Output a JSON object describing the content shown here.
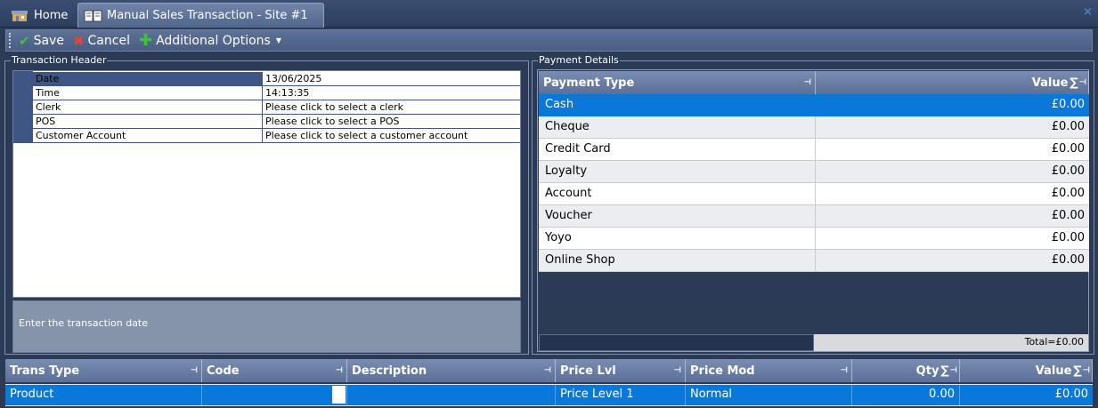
{
  "tabs": {
    "home": "Home",
    "active": "Manual Sales Transaction - Site #1",
    "close_glyph": "×"
  },
  "toolbar": {
    "save": "Save",
    "cancel": "Cancel",
    "additional": "Additional Options",
    "check_glyph": "✔",
    "x_glyph": "✖",
    "plus_glyph": "✚",
    "caret_glyph": "▼"
  },
  "transaction_header": {
    "title": "Transaction Header",
    "rows": [
      {
        "label": "Date",
        "value": "13/06/2025"
      },
      {
        "label": "Time",
        "value": "14:13:35"
      },
      {
        "label": "Clerk",
        "value": "Please click to select a clerk"
      },
      {
        "label": "POS",
        "value": "Please click to select a POS"
      },
      {
        "label": "Customer Account",
        "value": "Please click to select a customer account"
      }
    ],
    "hint": "Enter the transaction date"
  },
  "payment_details": {
    "title": "Payment Details",
    "col_type": "Payment Type",
    "col_value": "Value",
    "sigma": "∑",
    "pin": "⊣",
    "rows": [
      {
        "type": "Cash",
        "value": "£0.00"
      },
      {
        "type": "Cheque",
        "value": "£0.00"
      },
      {
        "type": "Credit Card",
        "value": "£0.00"
      },
      {
        "type": "Loyalty",
        "value": "£0.00"
      },
      {
        "type": "Account",
        "value": "£0.00"
      },
      {
        "type": "Voucher",
        "value": "£0.00"
      },
      {
        "type": "Yoyo",
        "value": "£0.00"
      },
      {
        "type": "Online Shop",
        "value": "£0.00"
      }
    ],
    "total": "Total=£0.00"
  },
  "lines": {
    "columns": {
      "trans_type": "Trans Type",
      "code": "Code",
      "description": "Description",
      "price_lvl": "Price Lvl",
      "price_mod": "Price Mod",
      "qty": "Qty",
      "value": "Value"
    },
    "row": {
      "trans_type": "Product",
      "code": "",
      "description": "",
      "price_lvl": "Price Level 1",
      "price_mod": "Normal",
      "qty": "0.00",
      "value": "£0.00"
    }
  },
  "colors": {
    "background": "#2b3a55",
    "selection": "#0a78d8",
    "header": "#5b6f98"
  }
}
